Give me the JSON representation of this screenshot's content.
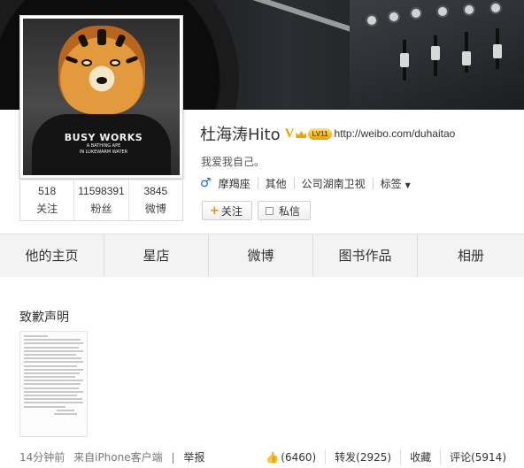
{
  "profile": {
    "name": "杜海涛Hito",
    "verified_mark": "V",
    "level_badge": "LV11",
    "url": "http://weibo.com/duhaitao",
    "bio": "我爱我自己。",
    "gender_icon": "male-icon",
    "info": [
      "摩羯座",
      "其他",
      "公司湖南卫视"
    ],
    "tags_label": "标签",
    "avatar_shirt": {
      "line1": "BUSY WORKS",
      "line2": "A BATHING APE",
      "line3": "IN LUKEWARM WATER"
    },
    "stats": [
      {
        "value": "518",
        "label": "关注"
      },
      {
        "value": "11598391",
        "label": "粉丝"
      },
      {
        "value": "3845",
        "label": "微博"
      }
    ],
    "follow_label": "关注",
    "follow_plus": "+",
    "message_label": "私信"
  },
  "tabs": [
    "他的主页",
    "星店",
    "微博",
    "图书作品",
    "相册"
  ],
  "post": {
    "title": "致歉声明",
    "time": "14分钟前",
    "source": "来自iPhone客户端",
    "report": "举报",
    "likes": "(6460)",
    "repost": "转发(2925)",
    "favorite": "收藏",
    "comment": "评论(5914)"
  },
  "colors": {
    "link_blue": "#2f7bd0",
    "accent_orange": "#f08a00",
    "vip_gold": "#e8a400"
  }
}
